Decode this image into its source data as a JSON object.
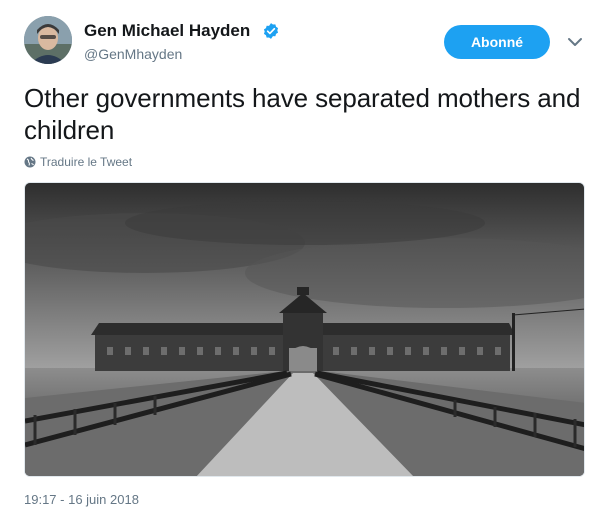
{
  "author": {
    "name": "Gen Michael Hayden",
    "handle": "@GenMhayden",
    "verified_icon": "verified-badge-icon"
  },
  "follow_button": {
    "label": "Abonné"
  },
  "menu": {
    "icon": "chevron-down-icon"
  },
  "tweet": {
    "text": "Other governments have separated mothers and children",
    "translate_label": "Traduire le Tweet",
    "translate_icon": "globe-icon",
    "timestamp": "19:17 - 16 juin 2018"
  },
  "media": {
    "icon": "tweet-photo"
  },
  "colors": {
    "accent": "#1da1f2",
    "secondary_text": "#657786"
  }
}
